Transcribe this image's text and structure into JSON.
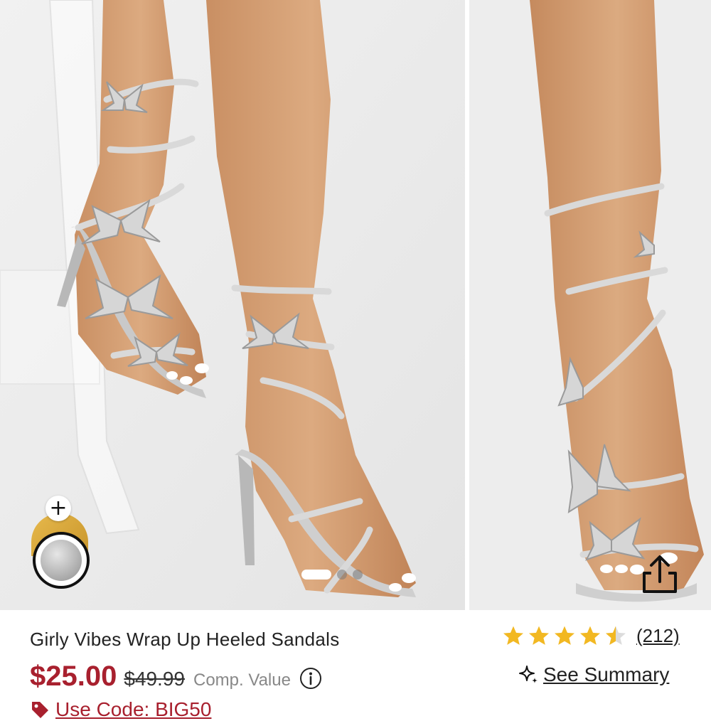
{
  "product": {
    "title": "Girly Vibes Wrap Up Heeled Sandals",
    "price": "$25.00",
    "original_price": "$49.99",
    "comp_value_label": "Comp. Value",
    "rating_value": 4.5,
    "review_count": "(212)",
    "see_summary_label": "See Summary",
    "promo_label": "Use Code: BIG50"
  },
  "gallery": {
    "image_count": 3,
    "active_index": 0
  },
  "swatches": {
    "add_symbol": "+",
    "colors": [
      "gold",
      "silver"
    ],
    "selected": "silver"
  },
  "icons": {
    "star": "star-icon",
    "info": "info-icon",
    "sparkle": "sparkle-icon",
    "tag": "tag-icon",
    "share": "share-icon",
    "plus": "plus-icon"
  },
  "colors": {
    "price": "#a8202e",
    "star": "#f2b822",
    "promo": "#a8202e"
  }
}
